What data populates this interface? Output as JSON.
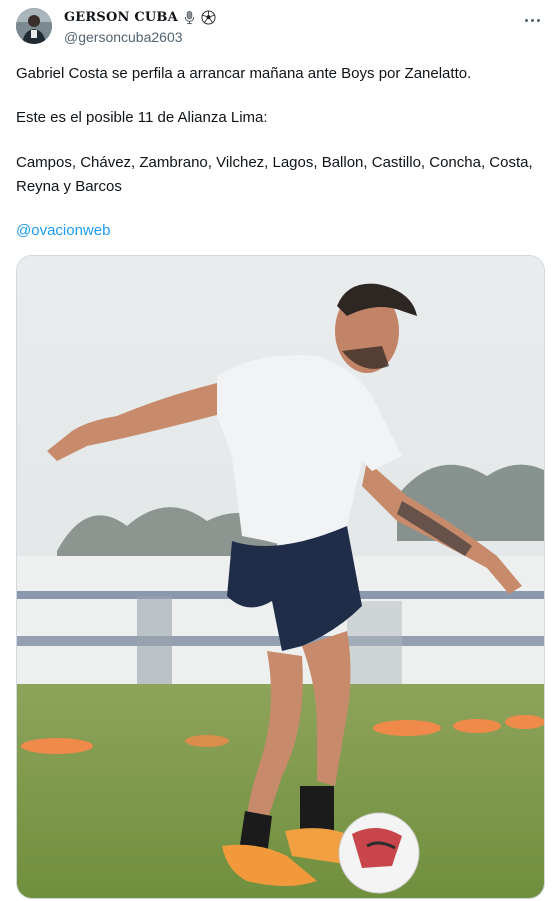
{
  "author": {
    "display_name": "GERSON CUBA",
    "handle": "@gersoncuba2603",
    "badge_icons": [
      "microphone-icon",
      "soccer-ball-icon"
    ]
  },
  "tweet": {
    "line1": "Gabriel Costa se perfila a arrancar mañana ante Boys por Zanelatto.",
    "line2": "Este es el posible 11 de Alianza Lima:",
    "line3": "Campos, Chávez, Zambrano, Vilchez, Lagos, Ballon, Castillo, Concha, Costa, Reyna y Barcos",
    "mention": "@ovacionweb"
  },
  "colors": {
    "text": "#0f1419",
    "secondary": "#536471",
    "link": "#1d9bf0",
    "border": "#cfd9de"
  }
}
